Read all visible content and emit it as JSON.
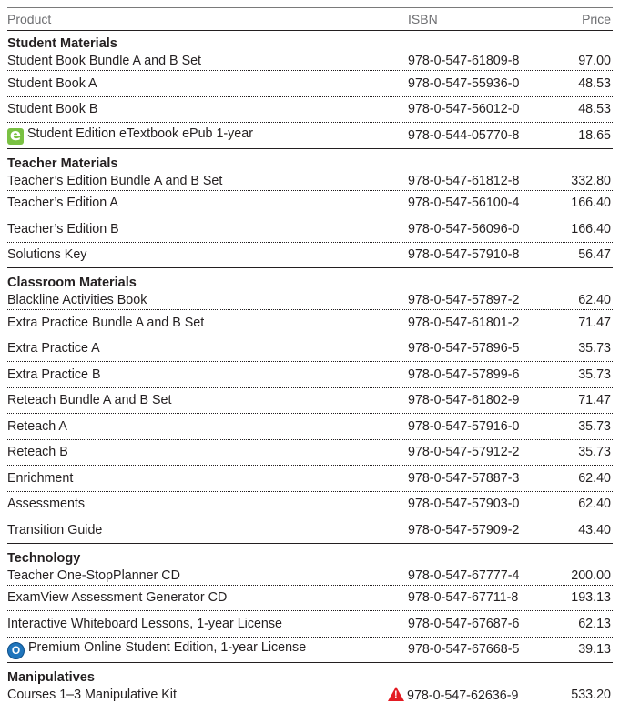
{
  "header": {
    "product": "Product",
    "isbn": "ISBN",
    "price": "Price"
  },
  "groups": [
    {
      "title": "Student Materials",
      "rows": [
        {
          "name": "Student Book Bundle A and B Set",
          "isbn": "978-0-547-61809-8",
          "price": "97.00",
          "icon": ""
        },
        {
          "name": "Student Book A",
          "isbn": "978-0-547-55936-0",
          "price": "48.53",
          "icon": ""
        },
        {
          "name": "Student Book B",
          "isbn": "978-0-547-56012-0",
          "price": "48.53",
          "icon": ""
        },
        {
          "name": "Student Edition eTextbook ePub 1-year",
          "isbn": "978-0-544-05770-8",
          "price": "18.65",
          "icon": "etextbook-e-icon"
        }
      ]
    },
    {
      "title": "Teacher Materials",
      "rows": [
        {
          "name": "Teacher’s Edition Bundle A and B Set",
          "isbn": "978-0-547-61812-8",
          "price": "332.80",
          "icon": ""
        },
        {
          "name": "Teacher’s Edition A",
          "isbn": "978-0-547-56100-4",
          "price": "166.40",
          "icon": ""
        },
        {
          "name": "Teacher’s Edition B",
          "isbn": "978-0-547-56096-0",
          "price": "166.40",
          "icon": ""
        },
        {
          "name": "Solutions Key",
          "isbn": "978-0-547-57910-8",
          "price": "56.47",
          "icon": ""
        }
      ]
    },
    {
      "title": "Classroom Materials",
      "rows": [
        {
          "name": "Blackline Activities Book",
          "isbn": "978-0-547-57897-2",
          "price": "62.40",
          "icon": ""
        },
        {
          "name": "Extra Practice Bundle A and B Set",
          "isbn": "978-0-547-61801-2",
          "price": "71.47",
          "icon": ""
        },
        {
          "name": "Extra Practice A",
          "isbn": "978-0-547-57896-5",
          "price": "35.73",
          "icon": ""
        },
        {
          "name": "Extra Practice B",
          "isbn": "978-0-547-57899-6",
          "price": "35.73",
          "icon": ""
        },
        {
          "name": "Reteach Bundle A and B Set",
          "isbn": "978-0-547-61802-9",
          "price": "71.47",
          "icon": ""
        },
        {
          "name": "Reteach A",
          "isbn": "978-0-547-57916-0",
          "price": "35.73",
          "icon": ""
        },
        {
          "name": "Reteach B",
          "isbn": "978-0-547-57912-2",
          "price": "35.73",
          "icon": ""
        },
        {
          "name": "Enrichment",
          "isbn": "978-0-547-57887-3",
          "price": "62.40",
          "icon": ""
        },
        {
          "name": "Assessments",
          "isbn": "978-0-547-57903-0",
          "price": "62.40",
          "icon": ""
        },
        {
          "name": "Transition Guide",
          "isbn": "978-0-547-57909-2",
          "price": "43.40",
          "icon": ""
        }
      ]
    },
    {
      "title": "Technology",
      "rows": [
        {
          "name": "Teacher One-StopPlanner CD",
          "isbn": "978-0-547-67777-4",
          "price": "200.00",
          "icon": ""
        },
        {
          "name": "ExamView Assessment Generator CD",
          "isbn": "978-0-547-67711-8",
          "price": "193.13",
          "icon": ""
        },
        {
          "name": "Interactive Whiteboard Lessons, 1-year License",
          "isbn": "978-0-547-67687-6",
          "price": "62.13",
          "icon": ""
        },
        {
          "name": "Premium Online Student Edition, 1-year License",
          "isbn": "978-0-547-67668-5",
          "price": "39.13",
          "icon": "online-o-icon"
        }
      ]
    },
    {
      "title": "Manipulatives",
      "rows": [
        {
          "name": "Courses 1–3 Manipulative Kit",
          "isbn": "978-0-547-62636-9",
          "price": "533.20",
          "icon": "",
          "isbn_icon": "warning-icon"
        }
      ]
    }
  ],
  "icon_glyphs": {
    "etextbook-e-icon": "e",
    "online-o-icon": "O"
  },
  "colors": {
    "etextbook": "#7ac143",
    "online": "#1f75bc",
    "warning": "#e31b23"
  }
}
